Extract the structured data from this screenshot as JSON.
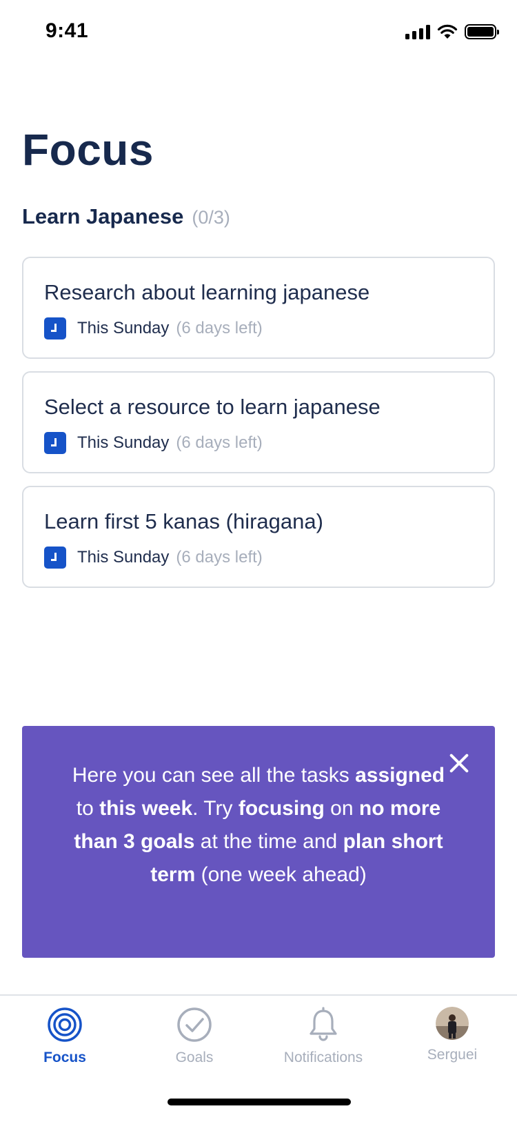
{
  "status_bar": {
    "time": "9:41"
  },
  "header": {
    "title": "Focus"
  },
  "section": {
    "title": "Learn Japanese",
    "count": "(0/3)"
  },
  "tasks": [
    {
      "title": "Research about learning japanese",
      "due": "This Sunday",
      "remaining": "(6 days left)"
    },
    {
      "title": "Select a resource to learn japanese",
      "due": "This Sunday",
      "remaining": "(6 days left)"
    },
    {
      "title": "Learn first 5 kanas (hiragana)",
      "due": "This Sunday",
      "remaining": "(6 days left)"
    }
  ],
  "tip": {
    "parts": [
      {
        "text": "Here you can see all the tasks ",
        "bold": false
      },
      {
        "text": "assigned",
        "bold": true
      },
      {
        "text": " to ",
        "bold": false
      },
      {
        "text": "this week",
        "bold": true
      },
      {
        "text": ". Try ",
        "bold": false
      },
      {
        "text": "focusing",
        "bold": true
      },
      {
        "text": " on ",
        "bold": false
      },
      {
        "text": "no more than 3 goals",
        "bold": true
      },
      {
        "text": " at the time and ",
        "bold": false
      },
      {
        "text": "plan short term",
        "bold": true
      },
      {
        "text": " (one week ahead)",
        "bold": false
      }
    ],
    "close_icon": "close-icon"
  },
  "tabs": [
    {
      "label": "Focus",
      "icon": "target-icon",
      "active": true
    },
    {
      "label": "Goals",
      "icon": "check-circle-icon",
      "active": false
    },
    {
      "label": "Notifications",
      "icon": "bell-icon",
      "active": false
    },
    {
      "label": "Serguei",
      "icon": "avatar",
      "active": false
    }
  ],
  "colors": {
    "accent": "#1653c8",
    "title": "#17294d",
    "muted": "#a7aebb",
    "tip_background": "#6655bf",
    "card_border": "#d9dde3"
  }
}
